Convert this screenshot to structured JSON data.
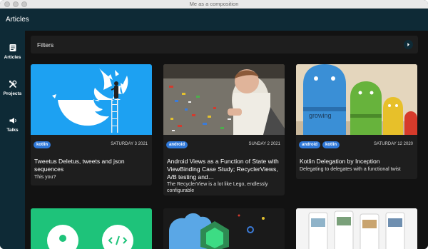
{
  "window": {
    "title": "Me as a composition"
  },
  "appbar": {
    "title": "Articles"
  },
  "sidebar": {
    "items": [
      {
        "label": "Articles",
        "icon": "article-icon"
      },
      {
        "label": "Projects",
        "icon": "tools-icon"
      },
      {
        "label": "Talks",
        "icon": "megaphone-icon"
      }
    ]
  },
  "filters": {
    "label": "Filters",
    "icon": "chevron-right-icon"
  },
  "articles": [
    {
      "tags": [
        "kotlin"
      ],
      "date": "SATURDAY 3 2021",
      "title": "Tweetus Deletus, tweets and json sequences",
      "description": "This you?"
    },
    {
      "tags": [
        "android"
      ],
      "date": "SUNDAY 2 2021",
      "title": "Android Views as a Function of State with ViewBinding Case Study; RecyclerViews, A/B testing and…",
      "description": "The RecyclerView is a lot like Lego, endlessly configurable"
    },
    {
      "tags": [
        "android",
        "kotlin"
      ],
      "date": "SATURDAY 12 2020",
      "title": "Kotlin Delegation by Inception",
      "description": "Delegating to delegates with a functional twist"
    }
  ],
  "colors": {
    "appbar": "#0e2a36",
    "background": "#121212",
    "card": "#1e1e1e",
    "tag": "#2f78d8",
    "twitter_blue": "#1da1f2"
  }
}
